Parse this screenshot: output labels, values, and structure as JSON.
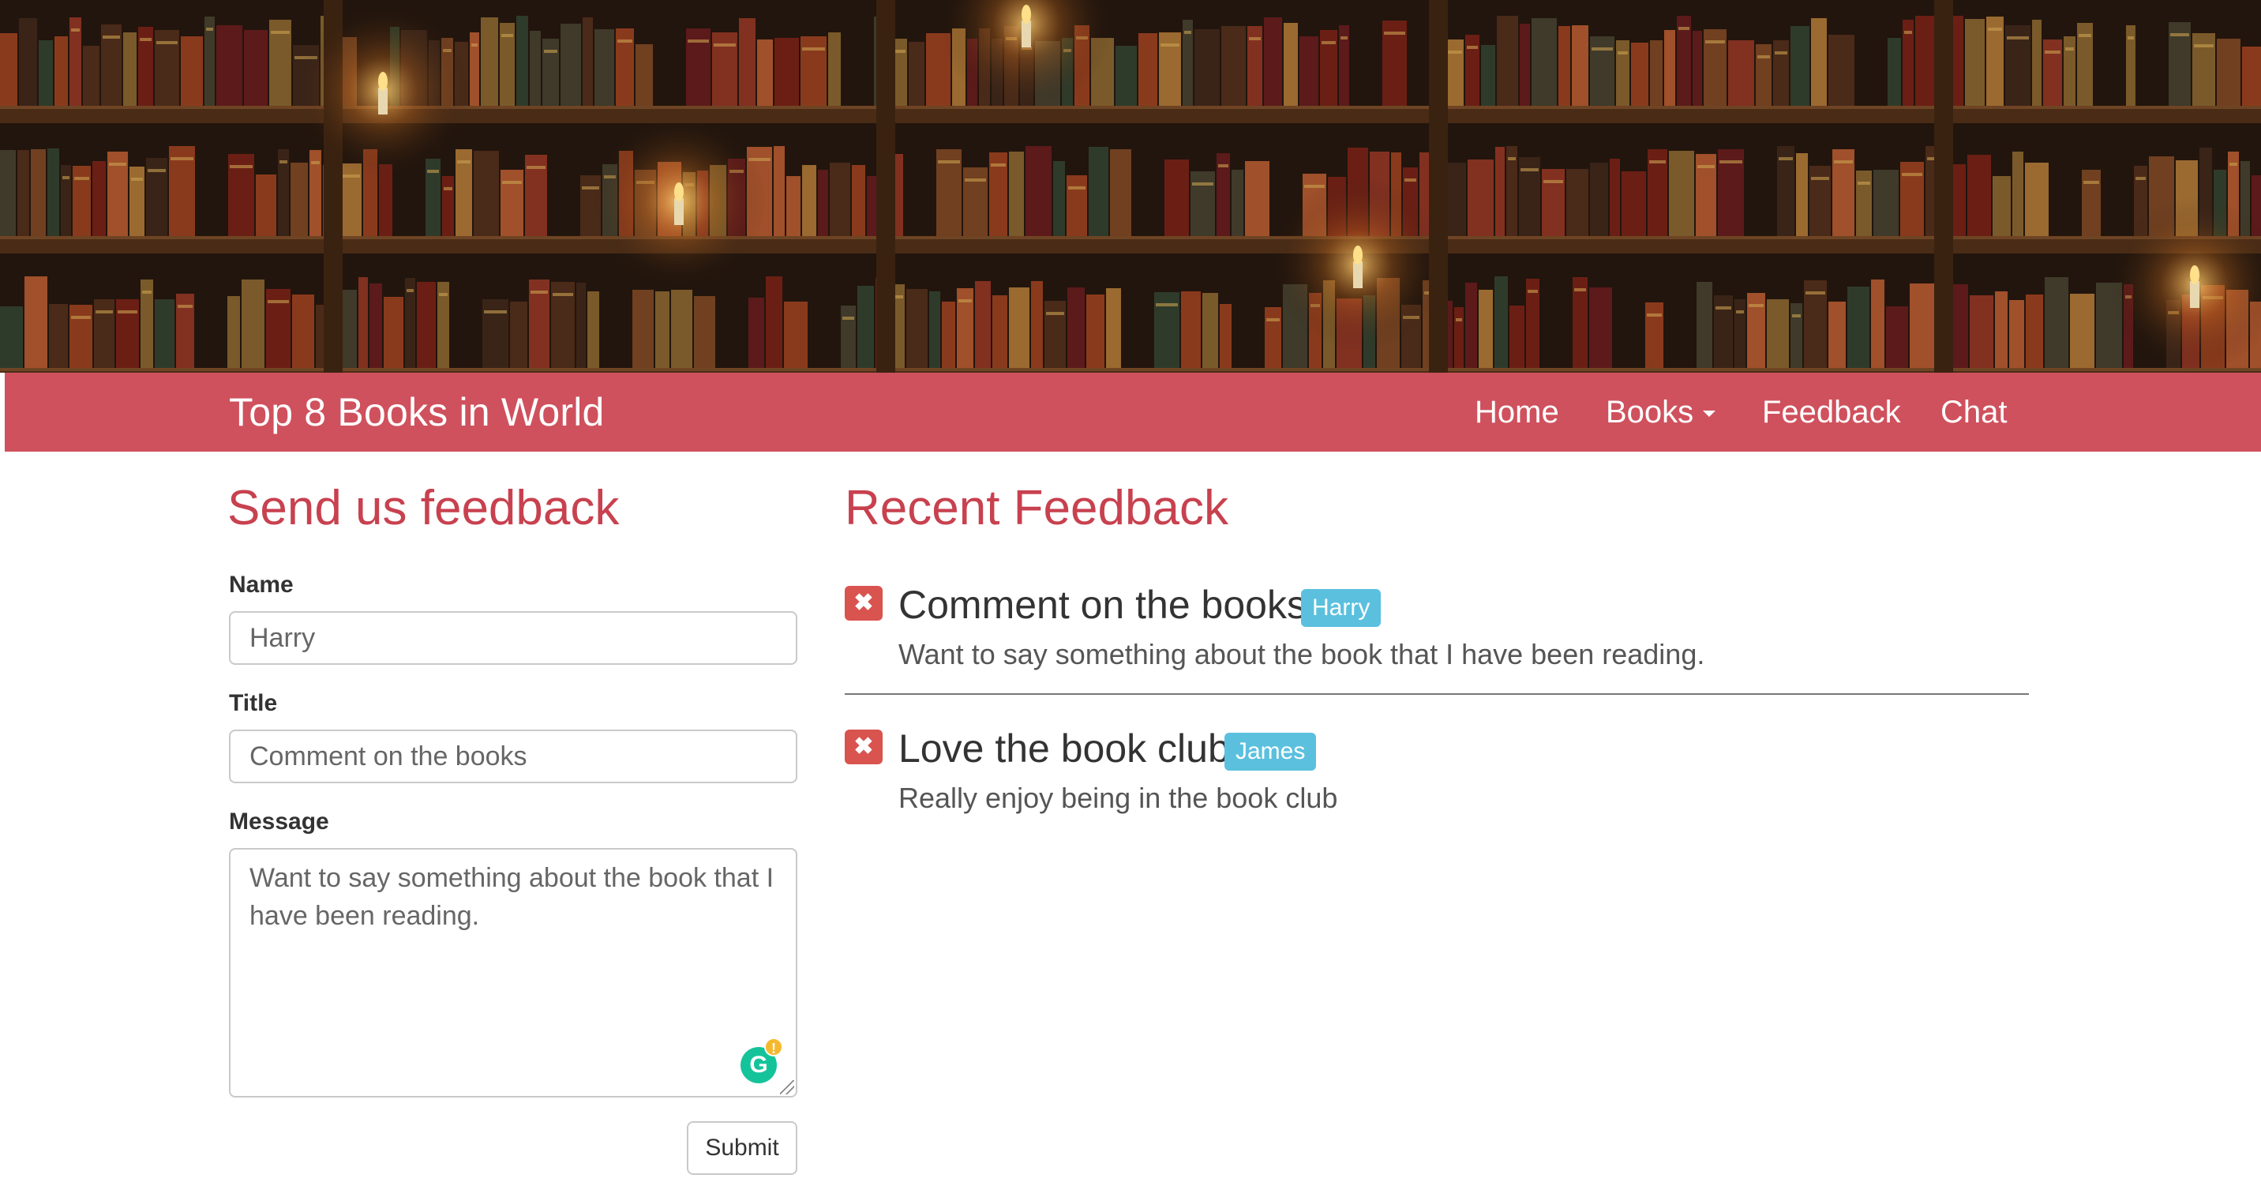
{
  "navbar": {
    "brand": "Top 8 Books in World",
    "links": [
      "Home",
      "Books",
      "Feedback",
      "Chat"
    ],
    "color": "#cf515d"
  },
  "form": {
    "heading": "Send us feedback",
    "name_label": "Name",
    "name_value": "Harry",
    "title_label": "Title",
    "title_value": "Comment on the books",
    "message_label": "Message",
    "message_value": "Want to say something about the book that I have been reading.",
    "submit_label": "Submit"
  },
  "feedback": {
    "heading": "Recent Feedback",
    "items": [
      {
        "title": "Comment on the books",
        "author": "Harry",
        "message": "Want to say something about the book that I have been reading."
      },
      {
        "title": "Love the book club",
        "author": "James",
        "message": "Really enjoy being in the book club"
      }
    ]
  },
  "icons": {
    "delete": "close-icon",
    "grammarly": "grammarly-icon"
  },
  "colors": {
    "heading": "#c8414f",
    "badge": "#5bc0de",
    "delete": "#d9534f"
  }
}
